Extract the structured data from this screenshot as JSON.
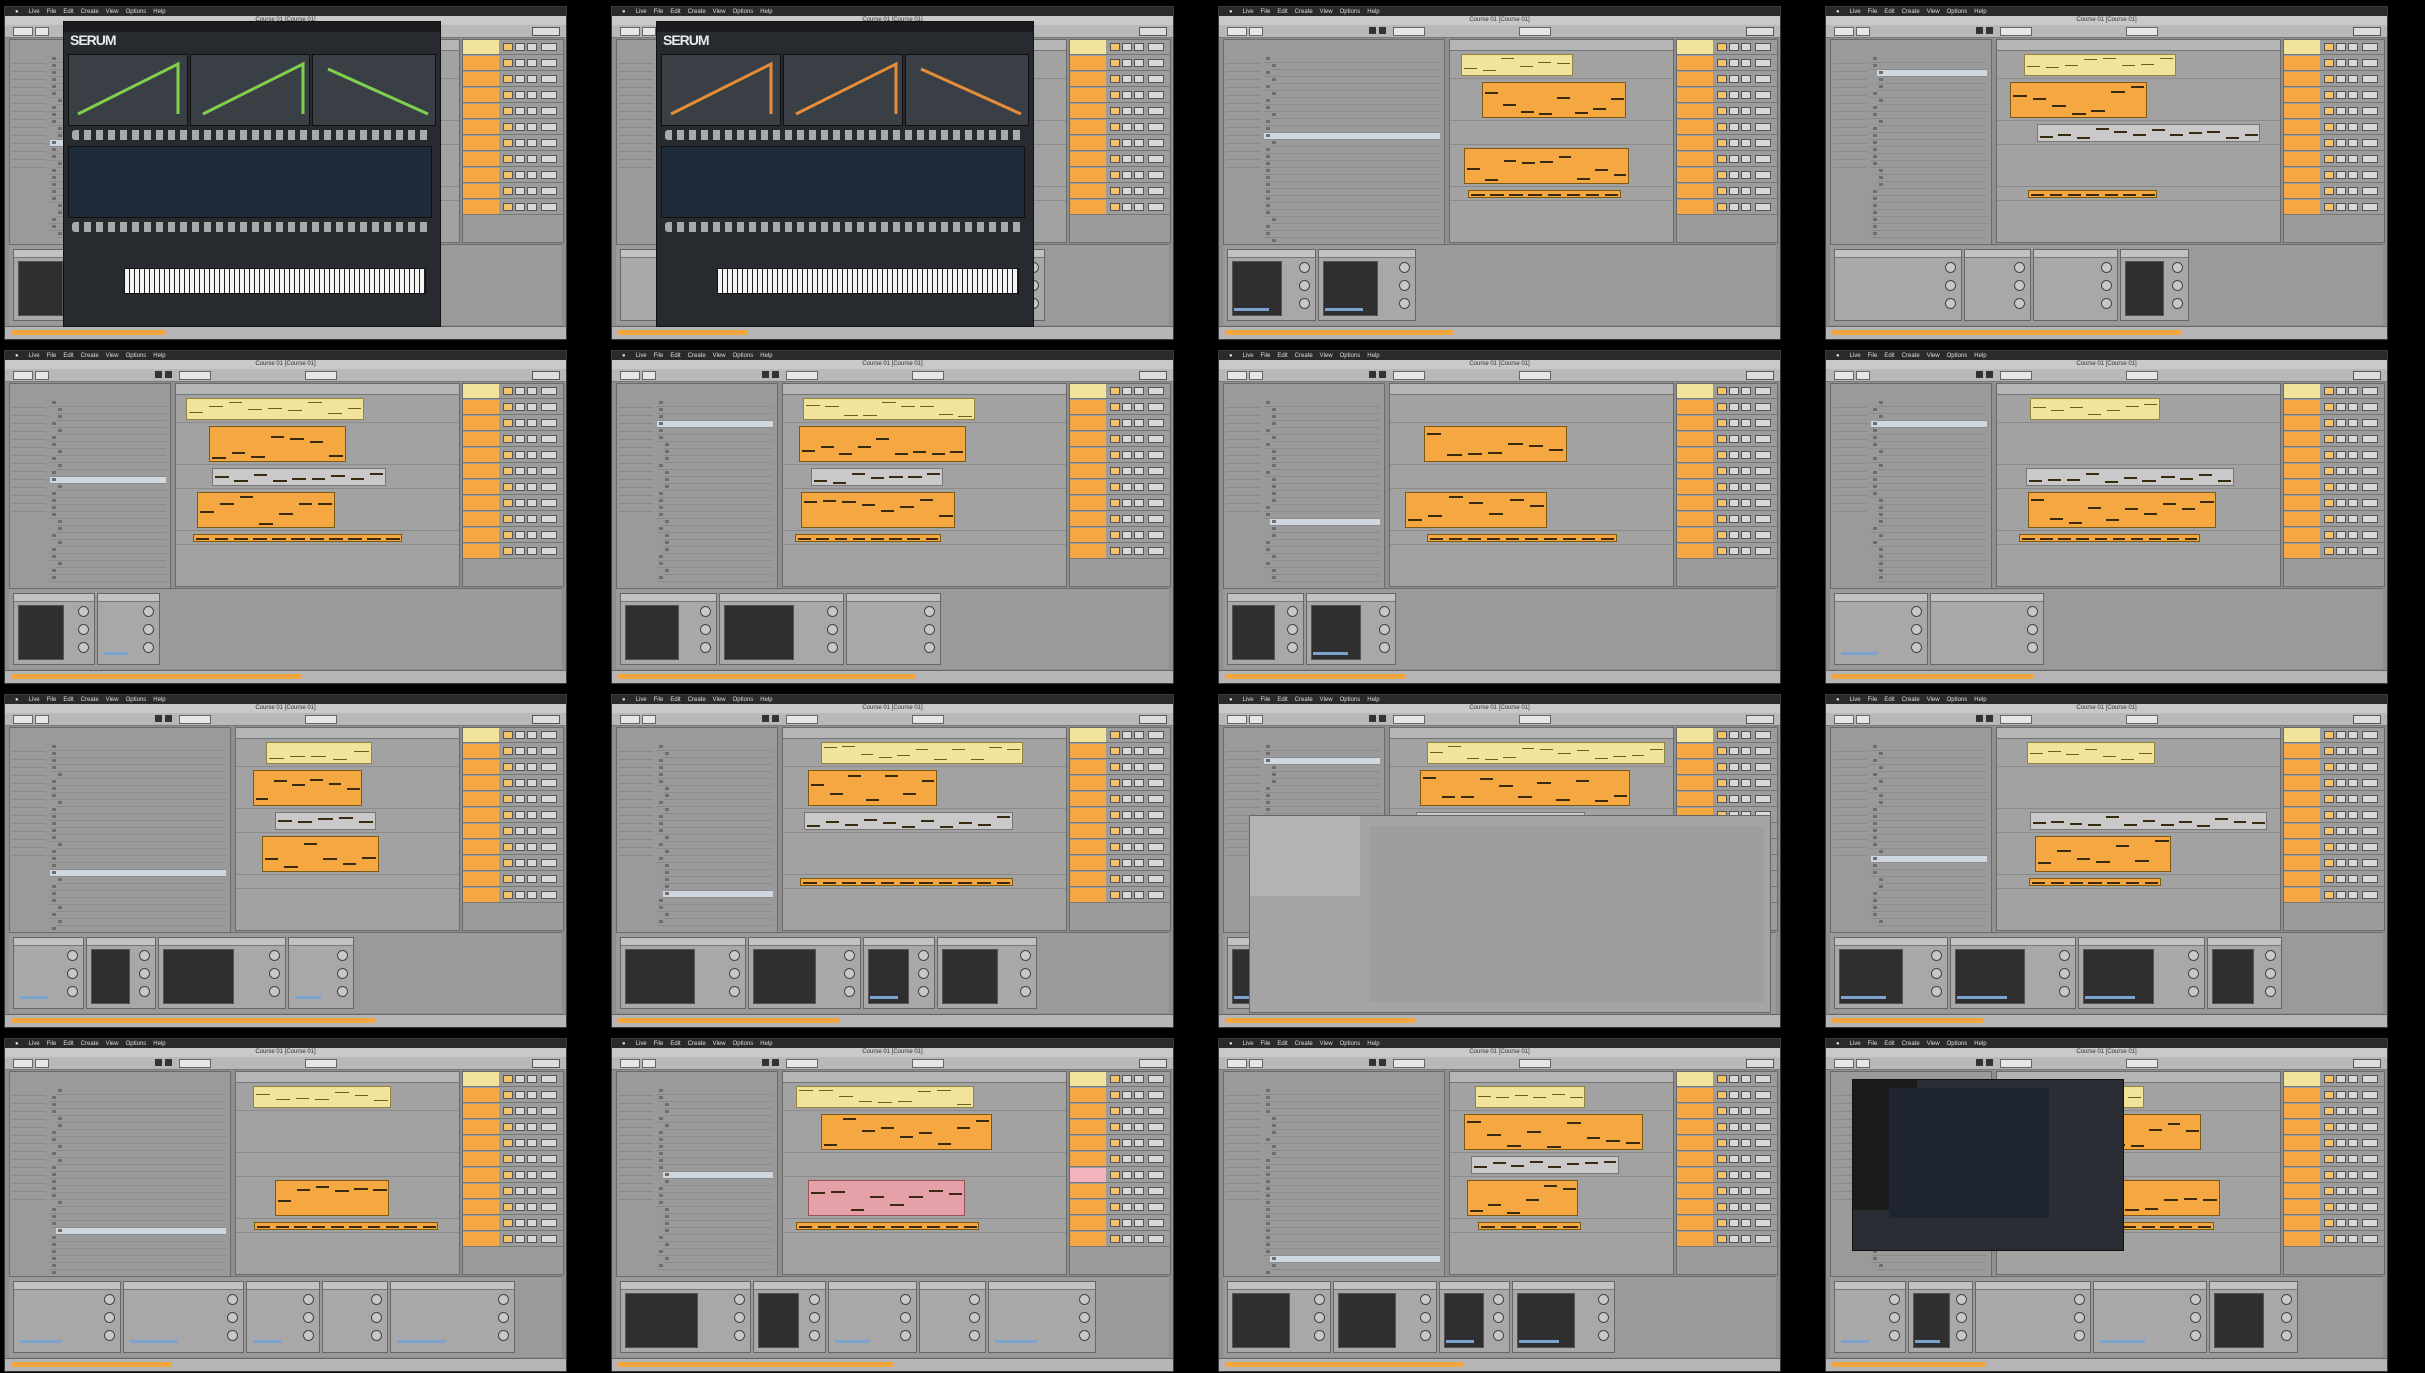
{
  "app": {
    "menu": [
      "Live",
      "File",
      "Edit",
      "Create",
      "View",
      "Options",
      "Help"
    ],
    "window_title": "Course 01 [Course 01]",
    "accent_orange": "#f5a741",
    "accent_yellow": "#f2e39a"
  },
  "frames": [
    {
      "id": "f1",
      "overlay": "serum",
      "browser": "normal"
    },
    {
      "id": "f2",
      "overlay": "serum-dark",
      "browser": "normal"
    },
    {
      "id": "f3",
      "overlay": "none",
      "browser": "wide"
    },
    {
      "id": "f4",
      "overlay": "none",
      "browser": "normal"
    },
    {
      "id": "f5",
      "overlay": "none",
      "browser": "normal"
    },
    {
      "id": "f6",
      "overlay": "none",
      "browser": "normal"
    },
    {
      "id": "f7",
      "overlay": "none",
      "browser": "normal"
    },
    {
      "id": "f8",
      "overlay": "none",
      "browser": "normal"
    },
    {
      "id": "f9",
      "overlay": "none",
      "browser": "wide"
    },
    {
      "id": "f10",
      "overlay": "none",
      "browser": "normal"
    },
    {
      "id": "f11",
      "overlay": "sampler",
      "browser": "normal"
    },
    {
      "id": "f12",
      "overlay": "none",
      "browser": "normal"
    },
    {
      "id": "f13",
      "overlay": "none",
      "browser": "wide"
    },
    {
      "id": "f14",
      "overlay": "none",
      "browser": "normal"
    },
    {
      "id": "f15",
      "overlay": "none",
      "browser": "wide"
    },
    {
      "id": "f16",
      "overlay": "filter",
      "browser": "normal"
    }
  ],
  "serum": {
    "logo": "SERUM"
  }
}
